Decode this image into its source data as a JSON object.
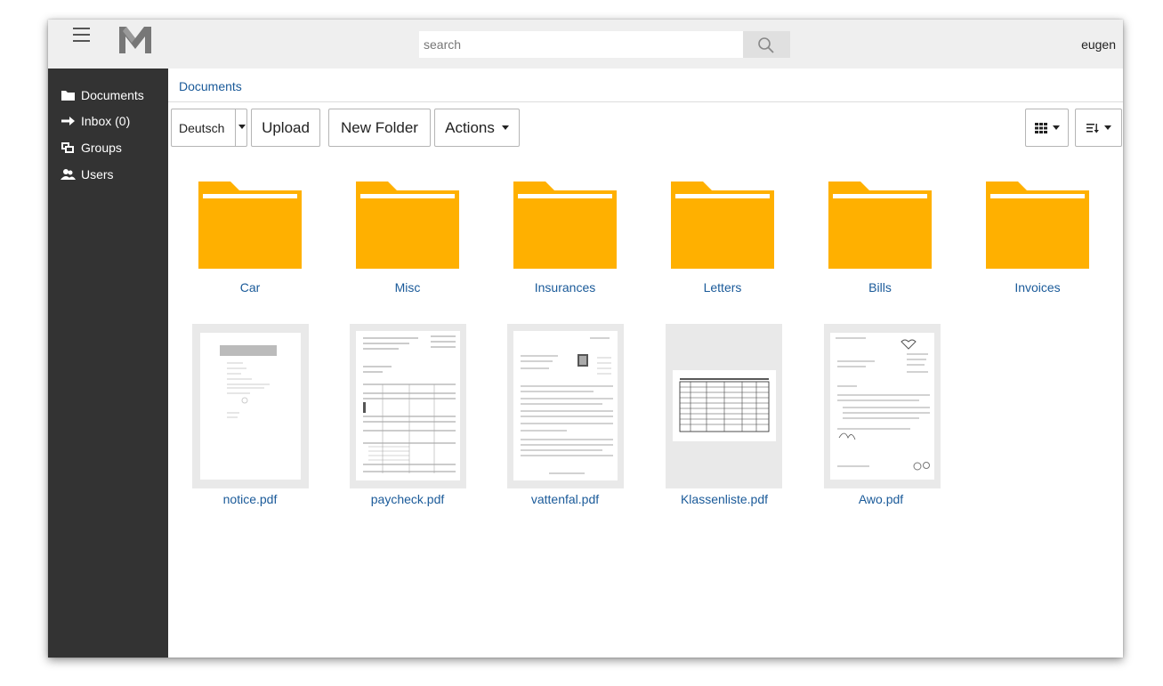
{
  "topbar": {
    "search_placeholder": "search",
    "username": "eugen"
  },
  "sidebar": {
    "items": [
      {
        "label": "Documents",
        "icon": "folder-icon"
      },
      {
        "label": "Inbox (0)",
        "icon": "arrow-right-icon"
      },
      {
        "label": "Groups",
        "icon": "groups-icon"
      },
      {
        "label": "Users",
        "icon": "users-icon"
      }
    ]
  },
  "breadcrumb": {
    "root": "Documents"
  },
  "toolbar": {
    "language_value": "Deutsch",
    "upload_label": "Upload",
    "new_folder_label": "New Folder",
    "actions_label": "Actions",
    "view_mode_icon": "grid-view-icon",
    "sort_icon": "sort-icon"
  },
  "folders": [
    {
      "name": "Car"
    },
    {
      "name": "Misc"
    },
    {
      "name": "Insurances"
    },
    {
      "name": "Letters"
    },
    {
      "name": "Bills"
    },
    {
      "name": "Invoices"
    }
  ],
  "files": [
    {
      "name": "notice.pdf"
    },
    {
      "name": "paycheck.pdf"
    },
    {
      "name": "vattenfal.pdf"
    },
    {
      "name": "Klassenliste.pdf"
    },
    {
      "name": "Awo.pdf"
    }
  ],
  "colors": {
    "folder": "#ffb000",
    "link": "#1a5a99",
    "sidebar_bg": "#333333",
    "topbar_bg": "#efefef"
  }
}
